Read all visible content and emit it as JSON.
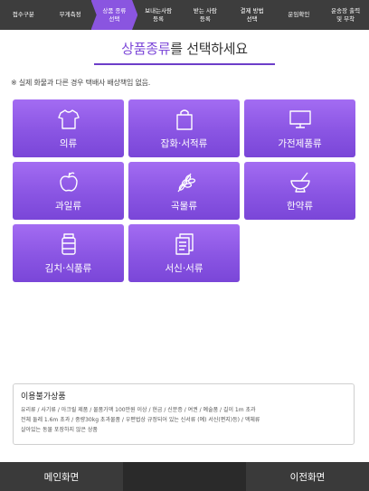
{
  "steps": [
    {
      "label": "접수구분"
    },
    {
      "label": "무게측정"
    },
    {
      "label": "상품 종류\n선택"
    },
    {
      "label": "보내는사람\n등록"
    },
    {
      "label": "받는 사람\n등록"
    },
    {
      "label": "결제 방법\n선택"
    },
    {
      "label": "운임확인"
    },
    {
      "label": "운송장 출력\n및 부착"
    }
  ],
  "active_step": 2,
  "heading": {
    "accent": "상품종류",
    "rest": "를 선택하세요"
  },
  "notice": "※ 실제 화물과 다른 경우 택배사 배상책임 없음.",
  "categories": [
    {
      "label": "의류",
      "icon": "shirt-icon"
    },
    {
      "label": "잡화·서적류",
      "icon": "shopping-bag-icon"
    },
    {
      "label": "가전제품류",
      "icon": "monitor-icon"
    },
    {
      "label": "과일류",
      "icon": "apple-icon"
    },
    {
      "label": "곡물류",
      "icon": "wheat-icon"
    },
    {
      "label": "한약류",
      "icon": "mortar-icon"
    },
    {
      "label": "김치·식품류",
      "icon": "jar-icon"
    },
    {
      "label": "서신·서류",
      "icon": "document-icon"
    }
  ],
  "prohibited": {
    "title": "이용불가상품",
    "lines": [
      "유리류 / 사기류 / 아크릴 제품 / 물품가액 100만원 이상 / 현금 / 신분증 / 여권 / 예술품 / 길이 1m 초과",
      "전체 둘레 1.6m 초과 / 중량30kg 초과물품 / 우편법상 규정되어 있는 신서류 (예) 서신(편지)등) / 액체류",
      "살아있는 동물 포장하지 않은 상품"
    ]
  },
  "buttons": {
    "main": "메인화면",
    "prev": "이전화면"
  },
  "colors": {
    "accent": "#8a55e0",
    "stepbar": "#3d3d3d",
    "bottombar": "#2d2d2d"
  }
}
